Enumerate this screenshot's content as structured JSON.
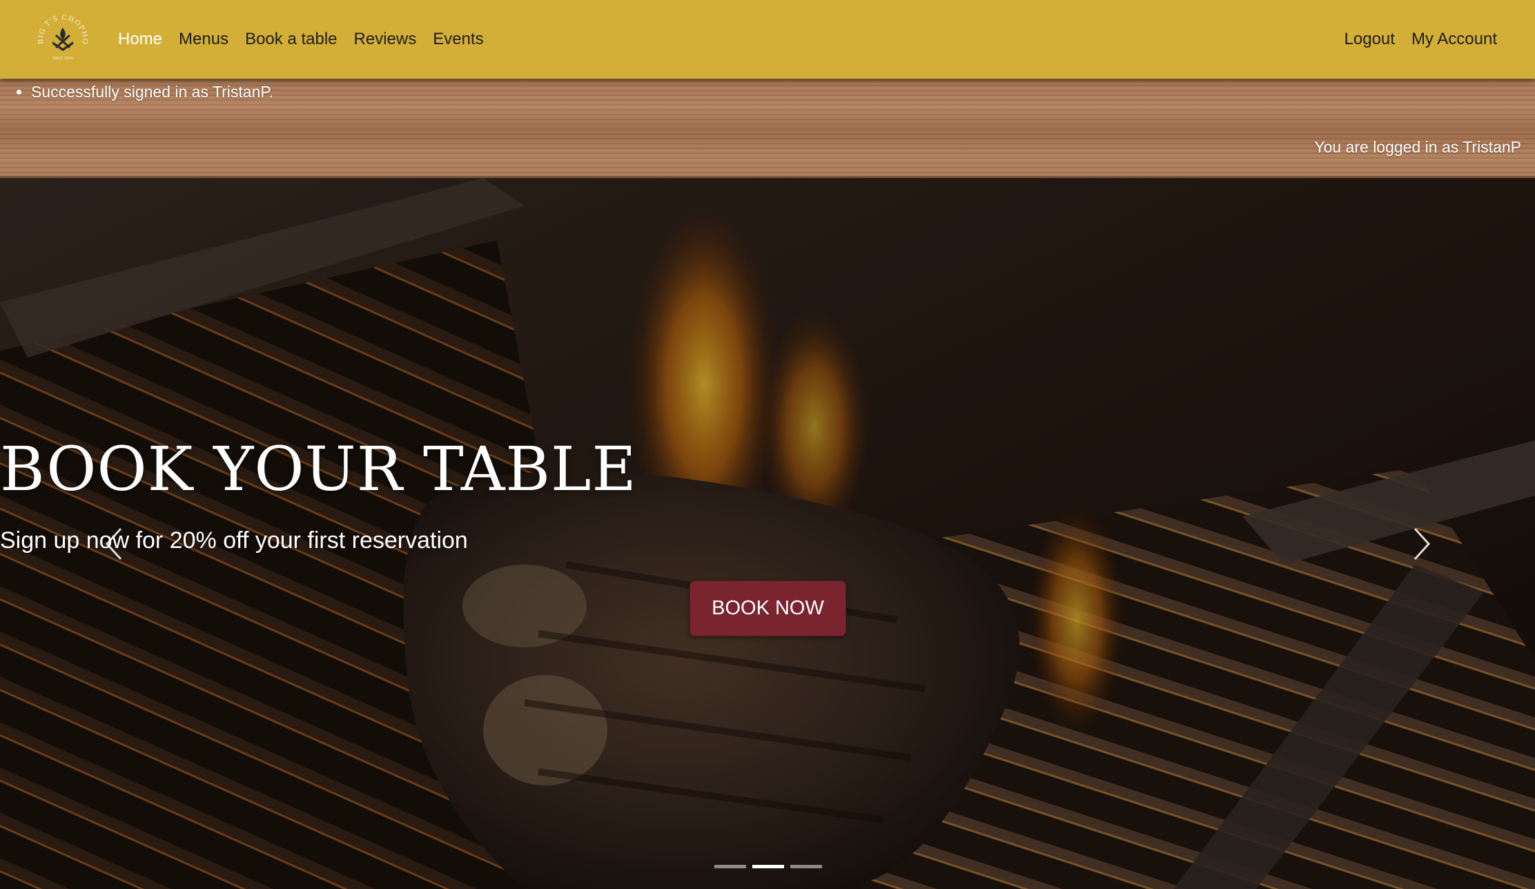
{
  "brand": {
    "logo_text": "BIG T'S CHOPHOUSE",
    "logo_since": "SINCE 2024"
  },
  "nav": {
    "items": [
      {
        "label": "Home",
        "active": true
      },
      {
        "label": "Menus"
      },
      {
        "label": "Book a table"
      },
      {
        "label": "Reviews"
      },
      {
        "label": "Events"
      }
    ],
    "logout_label": "Logout",
    "account_label": "My Account"
  },
  "messages": {
    "flash": [
      "Successfully signed in as TristanP."
    ],
    "logged_in_status": "You are logged in as TristanP"
  },
  "hero": {
    "title": "BOOK YOUR TABLE",
    "subtitle": "Sign up now for 20% off your first reservation",
    "cta_label": "BOOK NOW",
    "slide_count": 3,
    "active_slide": 2,
    "background_icon": "steak-on-grill-image"
  },
  "colors": {
    "navbar": "#d4af37",
    "cta": "#7a2430",
    "nav_text": "#1c1c1c",
    "nav_active": "#ffffff"
  }
}
